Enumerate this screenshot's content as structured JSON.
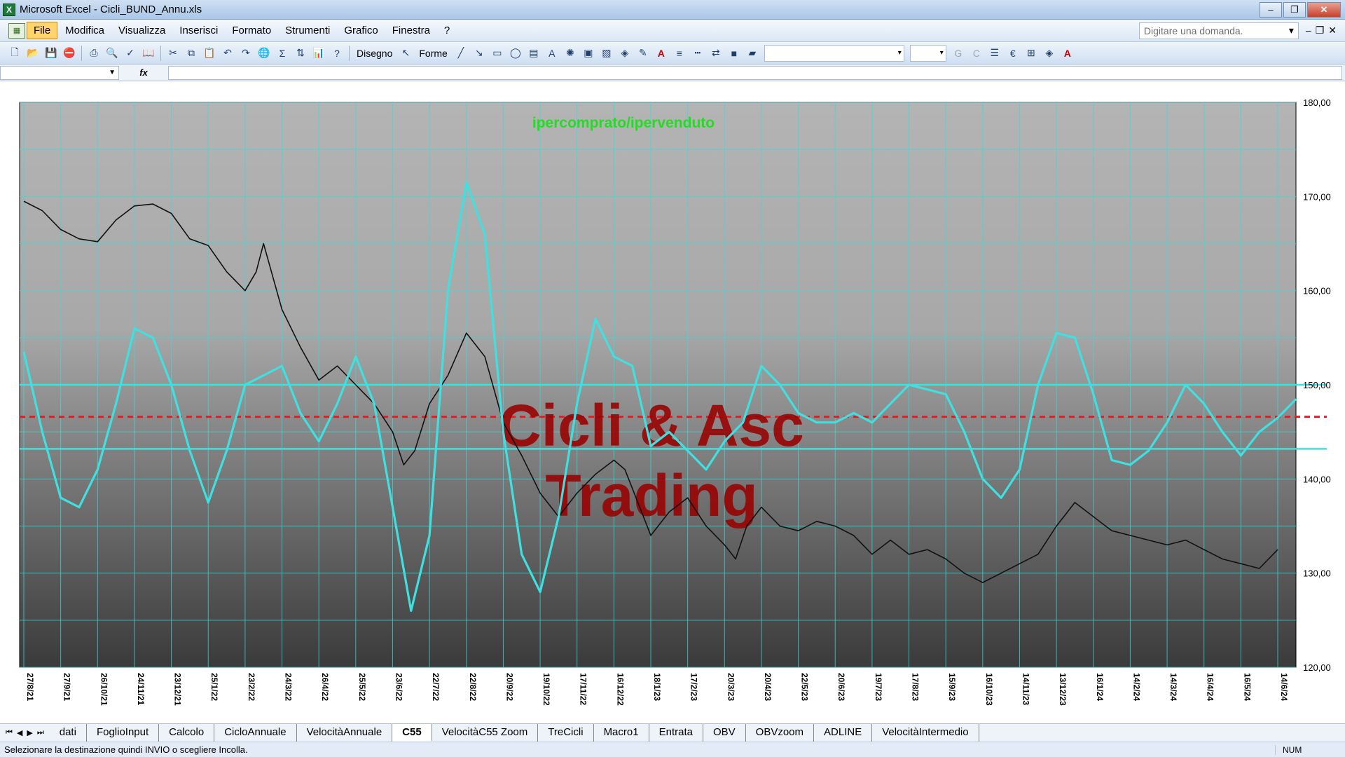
{
  "window": {
    "title": "Microsoft Excel - Cicli_BUND_Annu.xls",
    "min": "–",
    "max": "❐",
    "close": "✕",
    "app_icon": "excel-icon"
  },
  "menu": {
    "items": [
      "File",
      "Modifica",
      "Visualizza",
      "Inserisci",
      "Formato",
      "Strumenti",
      "Grafico",
      "Finestra",
      "?"
    ],
    "ask_placeholder": "Digitare una domanda."
  },
  "toolbar": {
    "disegno": "Disegno",
    "forme": "Forme"
  },
  "formula": {
    "fx": "fx"
  },
  "chart_data": {
    "type": "line",
    "title": "ipercomprato/ipervenduto",
    "watermark": [
      "Cicli & Asc",
      "Trading"
    ],
    "ylim": [
      120,
      180
    ],
    "yticks": [
      "120,00",
      "130,00",
      "140,00",
      "150,00",
      "160,00",
      "170,00",
      "180,00"
    ],
    "grid": true,
    "x_labels": [
      "27/8/21",
      "27/9/21",
      "26/10/21",
      "24/11/21",
      "23/12/21",
      "25/1/22",
      "23/2/22",
      "24/3/22",
      "26/4/22",
      "25/5/22",
      "23/6/22",
      "22/7/22",
      "22/8/22",
      "20/9/22",
      "19/10/22",
      "17/11/22",
      "16/12/22",
      "18/1/23",
      "17/2/23",
      "20/3/23",
      "20/4/23",
      "22/5/23",
      "20/6/23",
      "19/7/23",
      "17/8/23",
      "15/9/23",
      "16/10/23",
      "14/11/23",
      "13/12/23",
      "16/1/24",
      "14/2/24",
      "14/3/24",
      "16/4/24",
      "16/5/24",
      "14/6/24"
    ],
    "reference_lines": [
      {
        "value": 150,
        "color": "#40e0e0",
        "style": "solid"
      },
      {
        "value": 146.6,
        "color": "#e02020",
        "style": "dashed"
      },
      {
        "value": 143.2,
        "color": "#40e0e0",
        "style": "solid"
      }
    ],
    "series": [
      {
        "color": "#111111",
        "points": [
          [
            0,
            169.5
          ],
          [
            0.5,
            168.5
          ],
          [
            1,
            166.5
          ],
          [
            1.5,
            165.5
          ],
          [
            2,
            165.2
          ],
          [
            2.5,
            167.5
          ],
          [
            3,
            169
          ],
          [
            3.5,
            169.2
          ],
          [
            4,
            168.2
          ],
          [
            4.5,
            165.5
          ],
          [
            5,
            164.8
          ],
          [
            5.5,
            162
          ],
          [
            6,
            160
          ],
          [
            6.3,
            162
          ],
          [
            6.5,
            165
          ],
          [
            7,
            158
          ],
          [
            7.5,
            154
          ],
          [
            8,
            150.5
          ],
          [
            8.5,
            152
          ],
          [
            9,
            150
          ],
          [
            9.5,
            148
          ],
          [
            10,
            145
          ],
          [
            10.3,
            141.5
          ],
          [
            10.6,
            143
          ],
          [
            11,
            148
          ],
          [
            11.5,
            151
          ],
          [
            12,
            155.5
          ],
          [
            12.5,
            153
          ],
          [
            13,
            146
          ],
          [
            13.5,
            142.5
          ],
          [
            14,
            138.5
          ],
          [
            14.5,
            136
          ],
          [
            15,
            138.5
          ],
          [
            15.5,
            140.5
          ],
          [
            16,
            142
          ],
          [
            16.3,
            141
          ],
          [
            16.8,
            136
          ],
          [
            17,
            134
          ],
          [
            17.5,
            136.5
          ],
          [
            18,
            138
          ],
          [
            18.5,
            135
          ],
          [
            19,
            133
          ],
          [
            19.3,
            131.5
          ],
          [
            19.6,
            135
          ],
          [
            20,
            137
          ],
          [
            20.5,
            135
          ],
          [
            21,
            134.5
          ],
          [
            21.5,
            135.5
          ],
          [
            22,
            135
          ],
          [
            22.5,
            134
          ],
          [
            23,
            132
          ],
          [
            23.5,
            133.5
          ],
          [
            24,
            132
          ],
          [
            24.5,
            132.5
          ],
          [
            25,
            131.5
          ],
          [
            25.5,
            130
          ],
          [
            26,
            129
          ],
          [
            26.5,
            130
          ],
          [
            27,
            131
          ],
          [
            27.5,
            132
          ],
          [
            28,
            135
          ],
          [
            28.5,
            137.5
          ],
          [
            29,
            136
          ],
          [
            29.5,
            134.5
          ],
          [
            30,
            134
          ],
          [
            30.5,
            133.5
          ],
          [
            31,
            133
          ],
          [
            31.5,
            133.5
          ],
          [
            32,
            132.5
          ],
          [
            32.5,
            131.5
          ],
          [
            33,
            131
          ],
          [
            33.5,
            130.5
          ],
          [
            34,
            132.5
          ]
        ]
      },
      {
        "color": "#40e0e0",
        "points": [
          [
            0,
            153.5
          ],
          [
            0.5,
            145
          ],
          [
            1,
            138
          ],
          [
            1.5,
            137
          ],
          [
            2,
            141
          ],
          [
            2.5,
            148
          ],
          [
            3,
            156
          ],
          [
            3.5,
            155
          ],
          [
            4,
            150
          ],
          [
            4.5,
            143
          ],
          [
            5,
            137.5
          ],
          [
            5.5,
            143
          ],
          [
            6,
            150
          ],
          [
            6.5,
            151
          ],
          [
            7,
            152
          ],
          [
            7.5,
            147
          ],
          [
            8,
            144
          ],
          [
            8.5,
            148
          ],
          [
            9,
            153
          ],
          [
            9.5,
            148
          ],
          [
            10,
            137
          ],
          [
            10.5,
            126
          ],
          [
            11,
            134
          ],
          [
            11.5,
            160
          ],
          [
            12,
            171.5
          ],
          [
            12.5,
            166
          ],
          [
            13,
            145
          ],
          [
            13.5,
            132
          ],
          [
            14,
            128
          ],
          [
            14.5,
            136
          ],
          [
            15,
            148
          ],
          [
            15.5,
            157
          ],
          [
            16,
            153
          ],
          [
            16.5,
            152
          ],
          [
            17,
            143.5
          ],
          [
            17.5,
            145
          ],
          [
            18,
            143
          ],
          [
            18.5,
            141
          ],
          [
            19,
            144
          ],
          [
            19.5,
            146
          ],
          [
            20,
            152
          ],
          [
            20.5,
            150
          ],
          [
            21,
            147
          ],
          [
            21.5,
            146
          ],
          [
            22,
            146
          ],
          [
            22.5,
            147
          ],
          [
            23,
            146
          ],
          [
            23.5,
            148
          ],
          [
            24,
            150
          ],
          [
            24.5,
            149.5
          ],
          [
            25,
            149
          ],
          [
            25.5,
            145
          ],
          [
            26,
            140
          ],
          [
            26.5,
            138
          ],
          [
            27,
            141
          ],
          [
            27.5,
            150
          ],
          [
            28,
            155.5
          ],
          [
            28.5,
            155
          ],
          [
            29,
            149
          ],
          [
            29.5,
            142
          ],
          [
            30,
            141.5
          ],
          [
            30.5,
            143
          ],
          [
            31,
            146
          ],
          [
            31.5,
            150
          ],
          [
            32,
            148
          ],
          [
            32.5,
            145
          ],
          [
            33,
            142.5
          ],
          [
            33.5,
            145
          ],
          [
            34,
            146.5
          ],
          [
            34.5,
            148.5
          ]
        ]
      }
    ]
  },
  "sheets": {
    "tabs": [
      "dati",
      "FoglioInput",
      "Calcolo",
      "CicloAnnuale",
      "VelocitàAnnuale",
      "C55",
      "VelocitàC55 Zoom",
      "TreCicli",
      "Macro1",
      "Entrata",
      "OBV",
      "OBVzoom",
      "ADLINE",
      "VelocitàIntermedio"
    ],
    "active": "C55"
  },
  "status": {
    "message": "Selezionare la destinazione quindi INVIO o scegliere Incolla.",
    "num": "NUM"
  }
}
